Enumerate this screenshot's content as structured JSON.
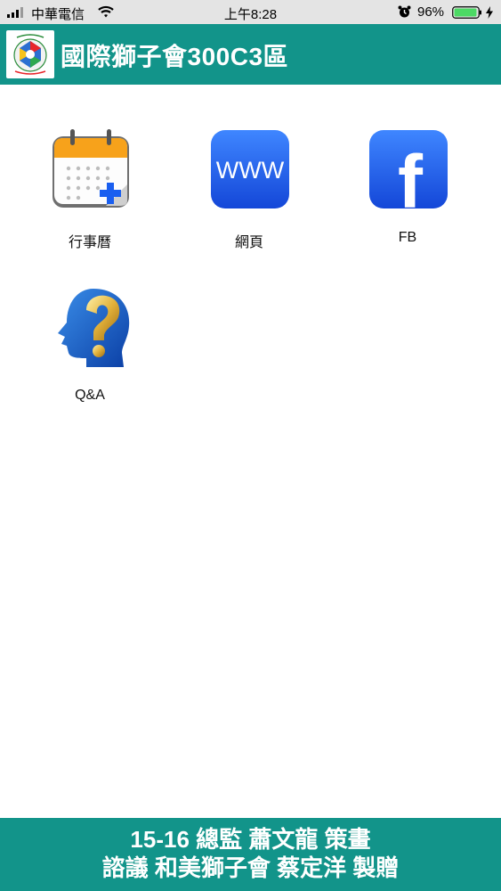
{
  "status_bar": {
    "carrier": "中華電信",
    "time": "上午8:28",
    "battery_percent": "96%",
    "battery_level": 0.96,
    "icons": [
      "signal-icon",
      "wifi-icon",
      "alarm-icon",
      "battery-icon",
      "charging-icon"
    ]
  },
  "header": {
    "title": "國際獅子會300C3區",
    "logo_icon": "lions-club-logo"
  },
  "apps": [
    {
      "label": "行事曆",
      "icon": "calendar-icon"
    },
    {
      "label": "網頁",
      "icon": "www-icon",
      "icon_text": "WWW"
    },
    {
      "label": "FB",
      "icon": "facebook-icon",
      "icon_text": "f"
    },
    {
      "label": "Q&A",
      "icon": "question-head-icon"
    }
  ],
  "footer": {
    "line1": "15-16 總監 蕭文龍 策畫",
    "line2": "諮議 和美獅子會 蔡定洋 製贈"
  },
  "colors": {
    "accent": "#12948a",
    "status_bar_bg": "#e4e4e4",
    "icon_blue": "#1a5ff0",
    "calendar_orange": "#f7a21b",
    "battery_green": "#4cd964"
  }
}
